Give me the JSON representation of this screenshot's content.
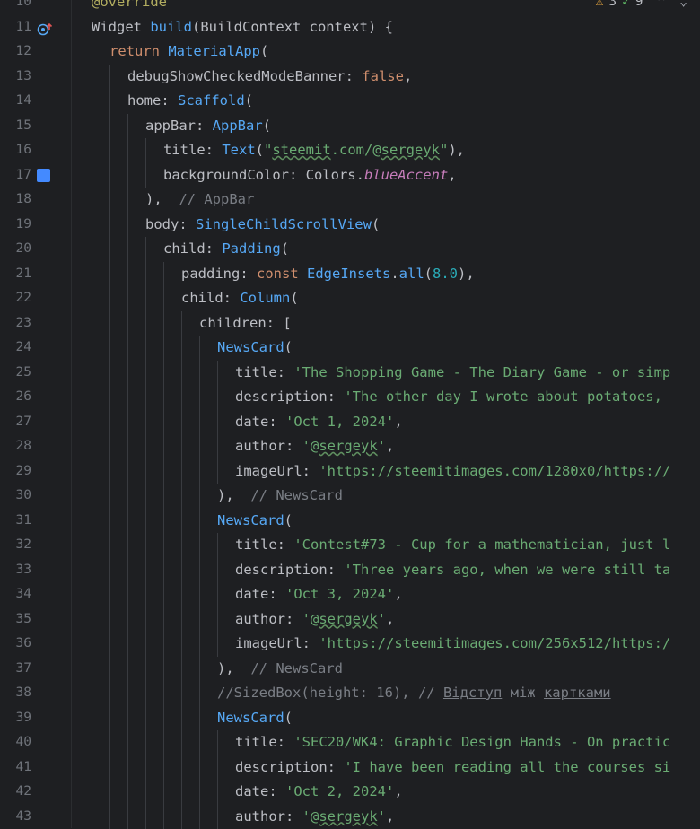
{
  "inspections": {
    "warnings": "3",
    "weak_warnings": "9"
  },
  "lines": [
    {
      "n": "10",
      "icon": "",
      "tokens": [
        [
          "ann",
          "@override"
        ]
      ]
    },
    {
      "n": "11",
      "icon": "override-marker-icon",
      "tokens": [
        [
          "",
          "Widget "
        ],
        [
          "fn",
          "build"
        ],
        [
          "",
          "(BuildContext context) {"
        ]
      ]
    },
    {
      "n": "12",
      "icon": "",
      "tokens": [
        [
          "kw",
          "return "
        ],
        [
          "cls",
          "MaterialApp"
        ],
        [
          "",
          "("
        ]
      ]
    },
    {
      "n": "13",
      "icon": "",
      "tokens": [
        [
          "",
          "debugShowCheckedModeBanner: "
        ],
        [
          "kw",
          "false"
        ],
        [
          "",
          ","
        ]
      ]
    },
    {
      "n": "14",
      "icon": "",
      "tokens": [
        [
          "",
          "home: "
        ],
        [
          "cls",
          "Scaffold"
        ],
        [
          "",
          "("
        ]
      ]
    },
    {
      "n": "15",
      "icon": "",
      "tokens": [
        [
          "",
          "appBar: "
        ],
        [
          "cls",
          "AppBar"
        ],
        [
          "",
          "("
        ]
      ]
    },
    {
      "n": "16",
      "icon": "",
      "tokens": [
        [
          "",
          "title: "
        ],
        [
          "cls",
          "Text"
        ],
        [
          "",
          "("
        ],
        [
          "str",
          "\""
        ],
        [
          "stru",
          "steemit"
        ],
        [
          "str",
          ".com/@"
        ],
        [
          "stru",
          "sergeyk"
        ],
        [
          "str",
          "\""
        ],
        [
          "",
          "),"
        ]
      ]
    },
    {
      "n": "17",
      "icon": "color-swatch-icon",
      "tokens": [
        [
          "",
          "backgroundColor: Colors."
        ],
        [
          "ital",
          "blueAccent"
        ],
        [
          "",
          ","
        ]
      ]
    },
    {
      "n": "18",
      "icon": "",
      "tokens": [
        [
          "",
          "),  "
        ],
        [
          "cmt",
          "// AppBar"
        ]
      ]
    },
    {
      "n": "19",
      "icon": "",
      "tokens": [
        [
          "",
          "body: "
        ],
        [
          "cls",
          "SingleChildScrollView"
        ],
        [
          "",
          "("
        ]
      ]
    },
    {
      "n": "20",
      "icon": "",
      "tokens": [
        [
          "",
          "child: "
        ],
        [
          "cls",
          "Padding"
        ],
        [
          "",
          "("
        ]
      ]
    },
    {
      "n": "21",
      "icon": "",
      "tokens": [
        [
          "",
          "padding: "
        ],
        [
          "kw",
          "const "
        ],
        [
          "cls",
          "EdgeInsets"
        ],
        [
          "",
          "."
        ],
        [
          "fn",
          "all"
        ],
        [
          "",
          "("
        ],
        [
          "num",
          "8.0"
        ],
        [
          "",
          "),"
        ]
      ]
    },
    {
      "n": "22",
      "icon": "",
      "tokens": [
        [
          "",
          "child: "
        ],
        [
          "cls",
          "Column"
        ],
        [
          "",
          "("
        ]
      ]
    },
    {
      "n": "23",
      "icon": "",
      "tokens": [
        [
          "",
          "children: ["
        ]
      ]
    },
    {
      "n": "24",
      "icon": "",
      "tokens": [
        [
          "cls",
          "NewsCard"
        ],
        [
          "",
          "("
        ]
      ]
    },
    {
      "n": "25",
      "icon": "",
      "tokens": [
        [
          "",
          "title: "
        ],
        [
          "str",
          "'The Shopping Game - The Diary Game - or simp"
        ]
      ]
    },
    {
      "n": "26",
      "icon": "",
      "tokens": [
        [
          "",
          "description: "
        ],
        [
          "str",
          "'The other day I wrote about potatoes, "
        ]
      ]
    },
    {
      "n": "27",
      "icon": "",
      "tokens": [
        [
          "",
          "date: "
        ],
        [
          "str",
          "'Oct 1, 2024'"
        ],
        [
          "",
          ","
        ]
      ]
    },
    {
      "n": "28",
      "icon": "",
      "tokens": [
        [
          "",
          "author: "
        ],
        [
          "str",
          "'@"
        ],
        [
          "stru",
          "sergeyk"
        ],
        [
          "str",
          "'"
        ],
        [
          "",
          ","
        ]
      ]
    },
    {
      "n": "29",
      "icon": "",
      "tokens": [
        [
          "",
          "imageUrl: "
        ],
        [
          "str",
          "'https://steemitimages.com/1280x0/https://"
        ]
      ]
    },
    {
      "n": "30",
      "icon": "",
      "tokens": [
        [
          "",
          "),  "
        ],
        [
          "cmt",
          "// NewsCard"
        ]
      ]
    },
    {
      "n": "31",
      "icon": "",
      "tokens": [
        [
          "cls",
          "NewsCard"
        ],
        [
          "",
          "("
        ]
      ]
    },
    {
      "n": "32",
      "icon": "",
      "tokens": [
        [
          "",
          "title: "
        ],
        [
          "str",
          "'Contest#73 - Cup for a mathematician, just l"
        ]
      ]
    },
    {
      "n": "33",
      "icon": "",
      "tokens": [
        [
          "",
          "description: "
        ],
        [
          "str",
          "'Three years ago, when we were still ta"
        ]
      ]
    },
    {
      "n": "34",
      "icon": "",
      "tokens": [
        [
          "",
          "date: "
        ],
        [
          "str",
          "'Oct 3, 2024'"
        ],
        [
          "",
          ","
        ]
      ]
    },
    {
      "n": "35",
      "icon": "",
      "tokens": [
        [
          "",
          "author: "
        ],
        [
          "str",
          "'@"
        ],
        [
          "stru",
          "sergeyk"
        ],
        [
          "str",
          "'"
        ],
        [
          "",
          ","
        ]
      ]
    },
    {
      "n": "36",
      "icon": "",
      "tokens": [
        [
          "",
          "imageUrl: "
        ],
        [
          "str",
          "'https://steemitimages.com/256x512/https:/"
        ]
      ]
    },
    {
      "n": "37",
      "icon": "",
      "tokens": [
        [
          "",
          "),  "
        ],
        [
          "cmt",
          "// NewsCard"
        ]
      ]
    },
    {
      "n": "38",
      "icon": "",
      "tokens": [
        [
          "cmt",
          "//SizedBox(height: 16), // "
        ],
        [
          "cmtu",
          "Відступ"
        ],
        [
          "cmt",
          " між "
        ],
        [
          "cmtu",
          "картками"
        ]
      ]
    },
    {
      "n": "39",
      "icon": "",
      "tokens": [
        [
          "cls",
          "NewsCard"
        ],
        [
          "",
          "("
        ]
      ]
    },
    {
      "n": "40",
      "icon": "",
      "tokens": [
        [
          "",
          "title: "
        ],
        [
          "str",
          "'SEC20/WK4: Graphic Design Hands - On practic"
        ]
      ]
    },
    {
      "n": "41",
      "icon": "",
      "tokens": [
        [
          "",
          "description: "
        ],
        [
          "str",
          "'I have been reading all the courses si"
        ]
      ]
    },
    {
      "n": "42",
      "icon": "",
      "tokens": [
        [
          "",
          "date: "
        ],
        [
          "str",
          "'Oct 2, 2024'"
        ],
        [
          "",
          ","
        ]
      ]
    },
    {
      "n": "43",
      "icon": "",
      "tokens": [
        [
          "",
          "author: "
        ],
        [
          "str",
          "'@"
        ],
        [
          "stru",
          "sergeyk"
        ],
        [
          "str",
          "'"
        ],
        [
          "",
          ","
        ]
      ]
    }
  ],
  "colors": {
    "background": "#1e1f22",
    "swatch": "#448aff"
  }
}
